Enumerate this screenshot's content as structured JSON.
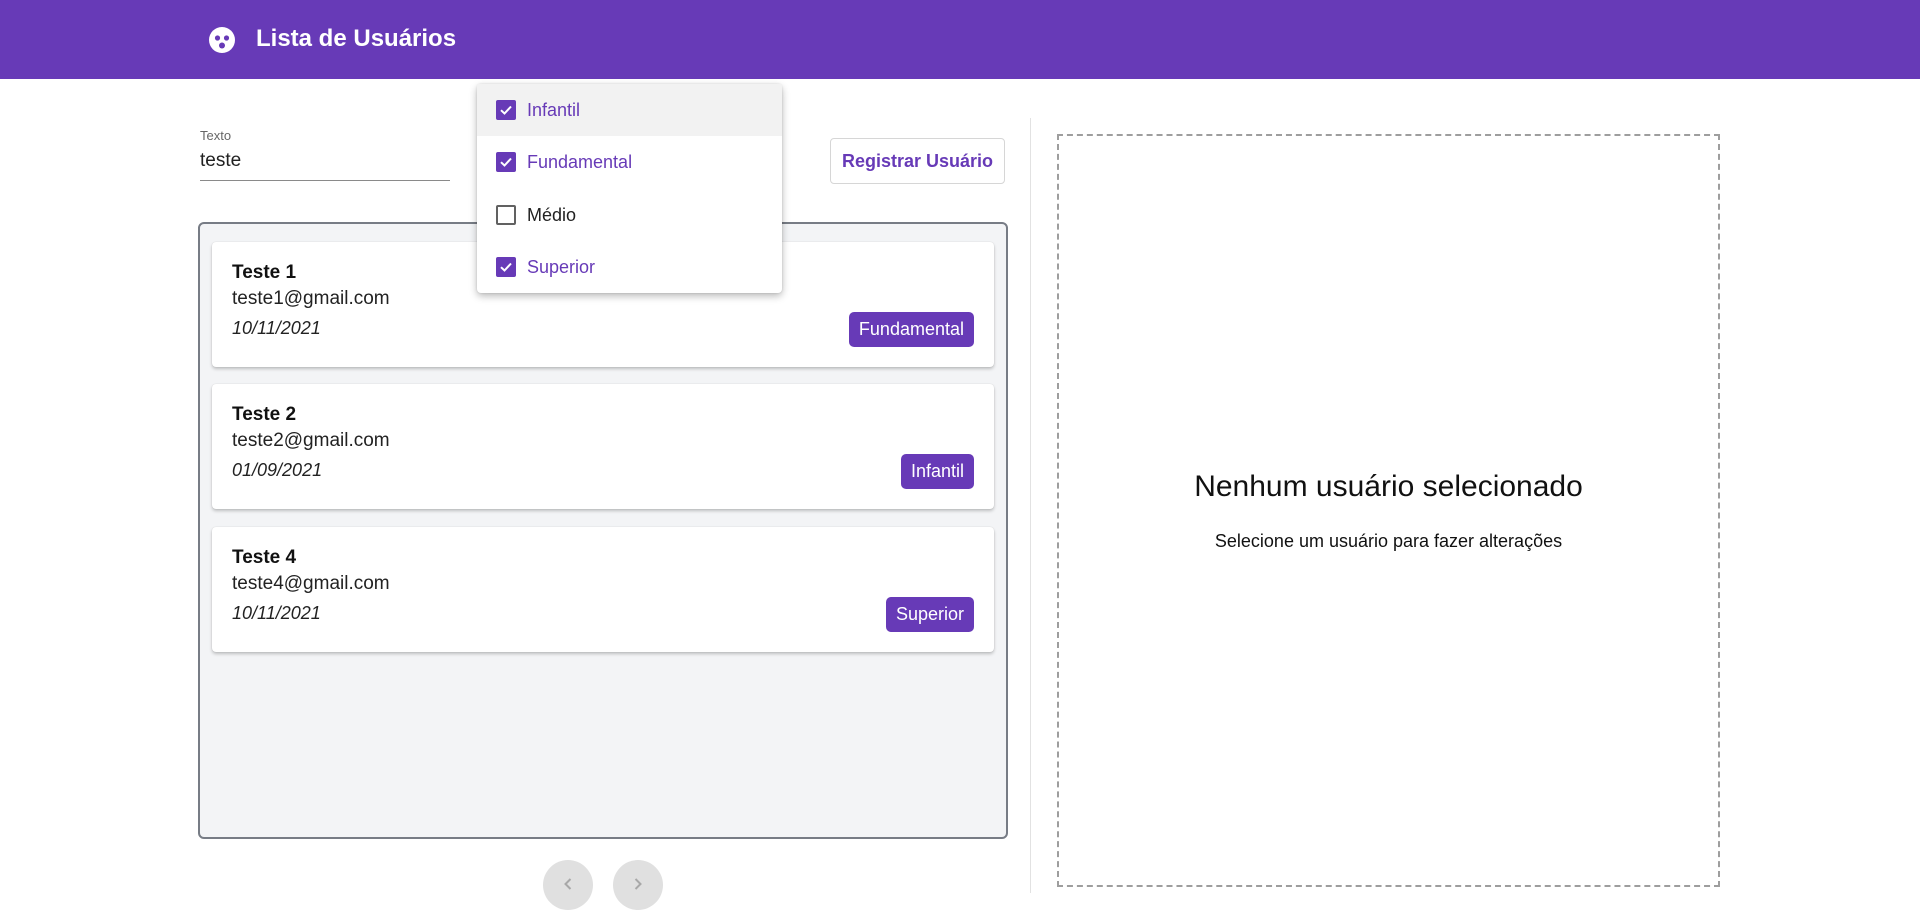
{
  "header": {
    "title": "Lista de Usuários",
    "logo_icon": "face-icon"
  },
  "search": {
    "label": "Texto",
    "value": "teste"
  },
  "register_label": "Registrar Usuário",
  "filter_menu": {
    "options": [
      {
        "label": "Infantil",
        "checked": true
      },
      {
        "label": "Fundamental",
        "checked": true
      },
      {
        "label": "Médio",
        "checked": false
      },
      {
        "label": "Superior",
        "checked": true
      }
    ]
  },
  "users": [
    {
      "name": "Teste 1",
      "email": "teste1@gmail.com",
      "date": "10/11/2021",
      "level": "Fundamental"
    },
    {
      "name": "Teste 2",
      "email": "teste2@gmail.com",
      "date": "01/09/2021",
      "level": "Infantil"
    },
    {
      "name": "Teste 4",
      "email": "teste4@gmail.com",
      "date": "10/11/2021",
      "level": "Superior"
    }
  ],
  "pagination": {
    "prev_icon": "chevron-left-icon",
    "next_icon": "chevron-right-icon"
  },
  "detail": {
    "empty_title": "Nenhum usuário selecionado",
    "empty_subtitle": "Selecione um usuário para fazer alterações"
  },
  "colors": {
    "primary": "#673ab7",
    "panel_bg": "#f3f4f6"
  }
}
